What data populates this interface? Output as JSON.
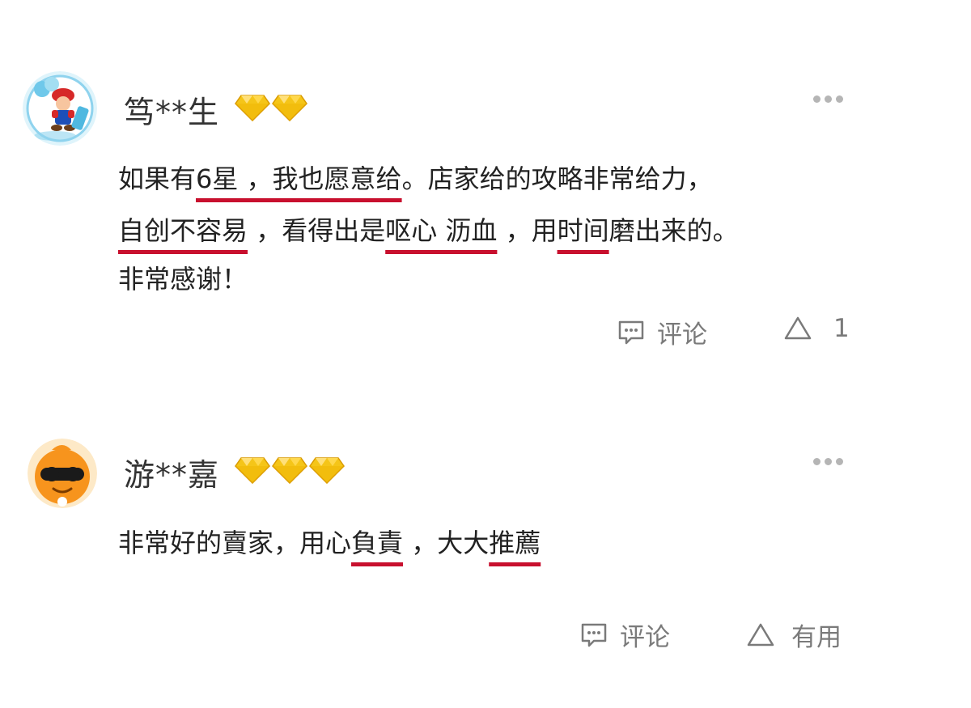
{
  "reviews": [
    {
      "username": "笃**生",
      "diamond_count": 2,
      "content_lines": [
        [
          "如果有",
          "6星 ，我也愿意给",
          "。店家给的攻略非常给力，"
        ],
        [
          "",
          "自创不容易",
          " ，看得出是",
          "呕心 沥血",
          " ，用",
          "时间",
          "磨出来的。"
        ],
        [
          "非常感谢！"
        ]
      ],
      "actions": {
        "comment_label": "评论",
        "like_label": "1"
      }
    },
    {
      "username": "游**嘉",
      "diamond_count": 3,
      "content_lines": [
        [
          "非常好的賣家，用心",
          "負責",
          " ，大大",
          "推薦"
        ]
      ],
      "actions": {
        "comment_label": "评论",
        "like_label": "有用"
      }
    }
  ],
  "icons": [
    "avatar-mario",
    "avatar-sunglasses",
    "diamond-icon",
    "more-icon",
    "comment-icon",
    "like-icon"
  ],
  "colors": {
    "highlight_underline": "#c8102e",
    "diamond_gold": "#f5c518",
    "muted_text": "#7a7a7a"
  }
}
